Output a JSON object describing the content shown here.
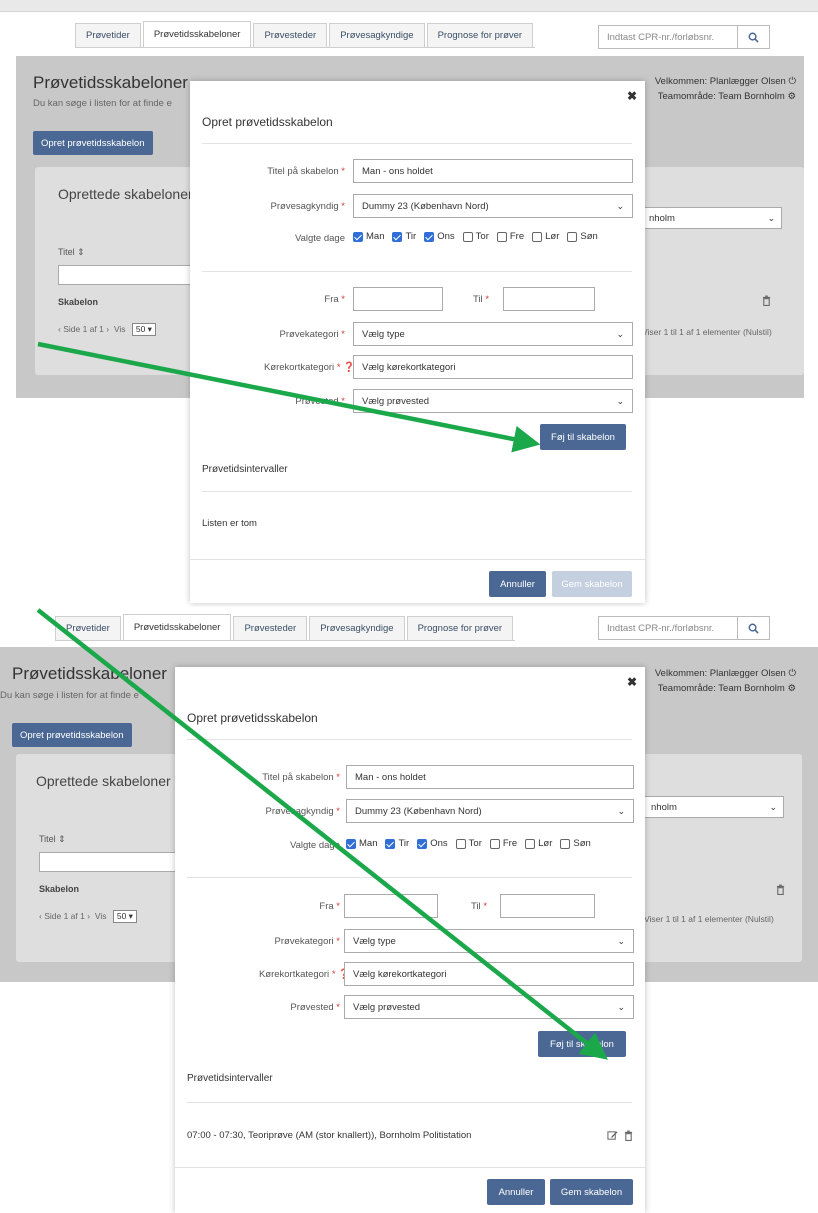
{
  "nav": {
    "tabs": [
      "Prøvetider",
      "Prøvetidsskabeloner",
      "Prøvesteder",
      "Prøvesagkyndige",
      "Prognose for prøver"
    ],
    "active_index": 1,
    "search_placeholder": "Indtast CPR-nr./forløbsnr."
  },
  "page": {
    "title": "Prøvetidsskabeloner",
    "subtitle": "Du kan søge i listen for at finde e",
    "create_button": "Opret prøvetidsskabelon",
    "welcome": "Velkommen: Planlægger Olsen",
    "team": "Teamområde: Team Bornholm"
  },
  "card": {
    "title": "Oprettede skabeloner",
    "column_title": "Titel",
    "row_label": "Skabelon",
    "pager_text": "Side 1 af 1",
    "vis_label": "Vis",
    "vis_value": "50",
    "region_select": "nholm",
    "info": "Viser 1 til 1 af 1 elementer",
    "reset": "(Nulstil)"
  },
  "modal": {
    "title": "Opret prøvetidsskabelon",
    "title_label": "Titel på skabelon",
    "title_value": "Man - ons holdet",
    "examiner_label": "Prøvesagkyndig",
    "examiner_value": "Dummy 23 (København Nord)",
    "days_label": "Valgte dage",
    "days": [
      {
        "label": "Man",
        "checked": true
      },
      {
        "label": "Tir",
        "checked": true
      },
      {
        "label": "Ons",
        "checked": true
      },
      {
        "label": "Tor",
        "checked": false
      },
      {
        "label": "Fre",
        "checked": false
      },
      {
        "label": "Lør",
        "checked": false
      },
      {
        "label": "Søn",
        "checked": false
      }
    ],
    "from_label": "Fra",
    "to_label": "Til",
    "category_label": "Prøvekategori",
    "category_value": "Vælg type",
    "license_label": "Kørekortkategori",
    "license_value": "Vælg kørekortkategori",
    "location_label": "Prøvested",
    "location_value": "Vælg prøvested",
    "add_button": "Føj til skabelon",
    "intervals_title": "Prøvetidsintervaller",
    "empty_text": "Listen er tom",
    "interval_entry": "07:00 - 07:30, Teoriprøve (AM (stor knallert)), Bornholm Politistation",
    "cancel_button": "Annuller",
    "save_button": "Gem skabelon",
    "required_mark": "*"
  },
  "colors": {
    "primary": "#4a6893",
    "disabled": "#c4d0e0",
    "arrow": "#1aa84a",
    "required": "#d43a3a",
    "checkbox": "#2f6fd6"
  }
}
